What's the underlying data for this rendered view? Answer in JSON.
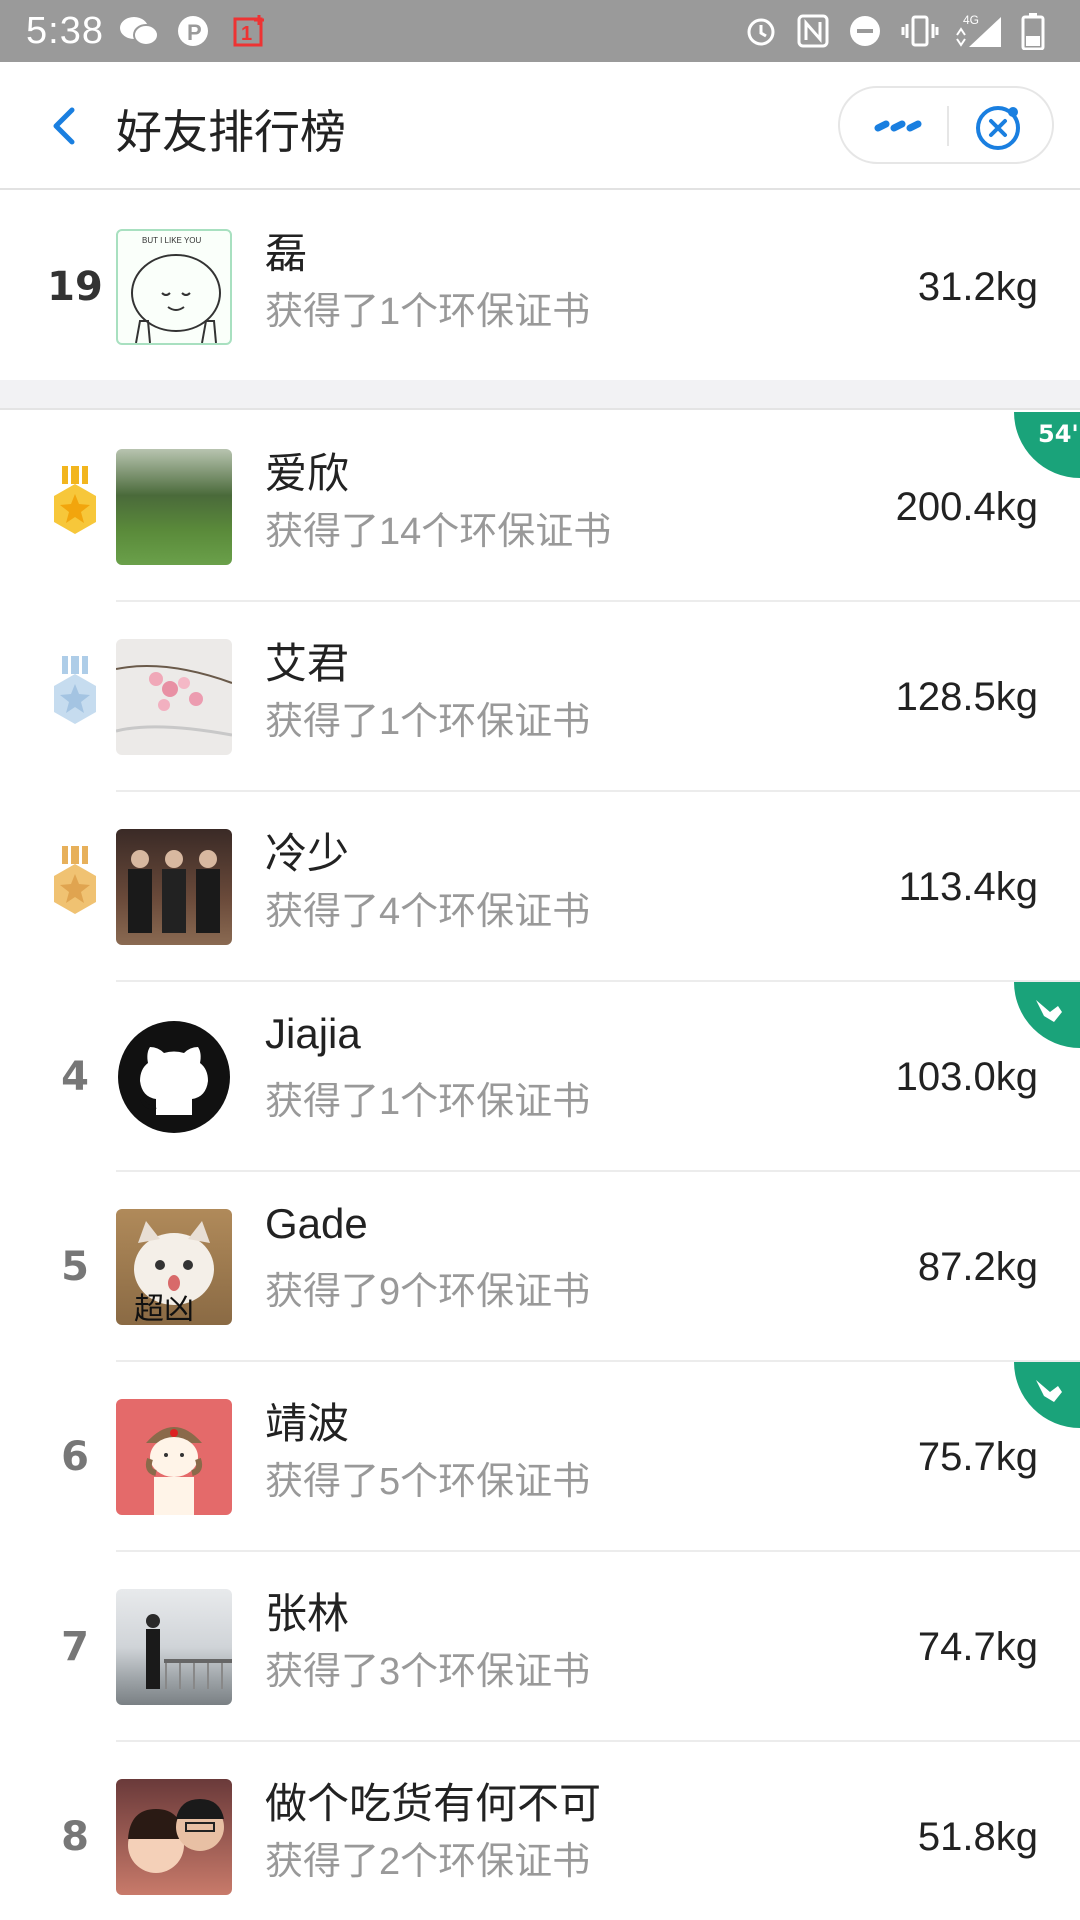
{
  "status_bar": {
    "time": "5:38",
    "left_icons": [
      "wechat-icon",
      "p-app-icon",
      "oneplus-icon"
    ],
    "right_icons": [
      "alarm-icon",
      "nfc-icon",
      "dnd-icon",
      "vibrate-icon",
      "signal-4g-icon",
      "battery-icon"
    ],
    "network": "4G"
  },
  "header": {
    "title": "好友排行榜",
    "back_icon": "chevron-left-icon",
    "more_icon": "more-dots-icon",
    "close_icon": "close-circle-icon"
  },
  "colors": {
    "accent_blue": "#1a7fe0",
    "green_badge": "#1aa37a",
    "gold_medal": "#f2b51d",
    "silver_medal": "#aecde8",
    "bronze_medal": "#e7b05a"
  },
  "my_entry": {
    "rank": "19",
    "name": "磊",
    "certificates": "获得了1个环保证书",
    "weight": "31.2kg"
  },
  "ranking": [
    {
      "rank": "1",
      "medal": "gold",
      "name": "爱欣",
      "certificates": "获得了14个环保证书",
      "weight": "200.4kg",
      "badge": "54'"
    },
    {
      "rank": "2",
      "medal": "silver",
      "name": "艾君",
      "certificates": "获得了1个环保证书",
      "weight": "128.5kg",
      "badge": ""
    },
    {
      "rank": "3",
      "medal": "bronze",
      "name": "冷少",
      "certificates": "获得了4个环保证书",
      "weight": "113.4kg",
      "badge": ""
    },
    {
      "rank": "4",
      "medal": "",
      "name": "Jiajia",
      "certificates": "获得了1个环保证书",
      "weight": "103.0kg",
      "badge": "hand"
    },
    {
      "rank": "5",
      "medal": "",
      "name": "Gade",
      "certificates": "获得了9个环保证书",
      "weight": "87.2kg",
      "badge": "",
      "avatar_caption": "超凶"
    },
    {
      "rank": "6",
      "medal": "",
      "name": "靖波",
      "certificates": "获得了5个环保证书",
      "weight": "75.7kg",
      "badge": "hand"
    },
    {
      "rank": "7",
      "medal": "",
      "name": "张林",
      "certificates": "获得了3个环保证书",
      "weight": "74.7kg",
      "badge": ""
    },
    {
      "rank": "8",
      "medal": "",
      "name": "做个吃货有何不可",
      "certificates": "获得了2个环保证书",
      "weight": "51.8kg",
      "badge": ""
    }
  ]
}
